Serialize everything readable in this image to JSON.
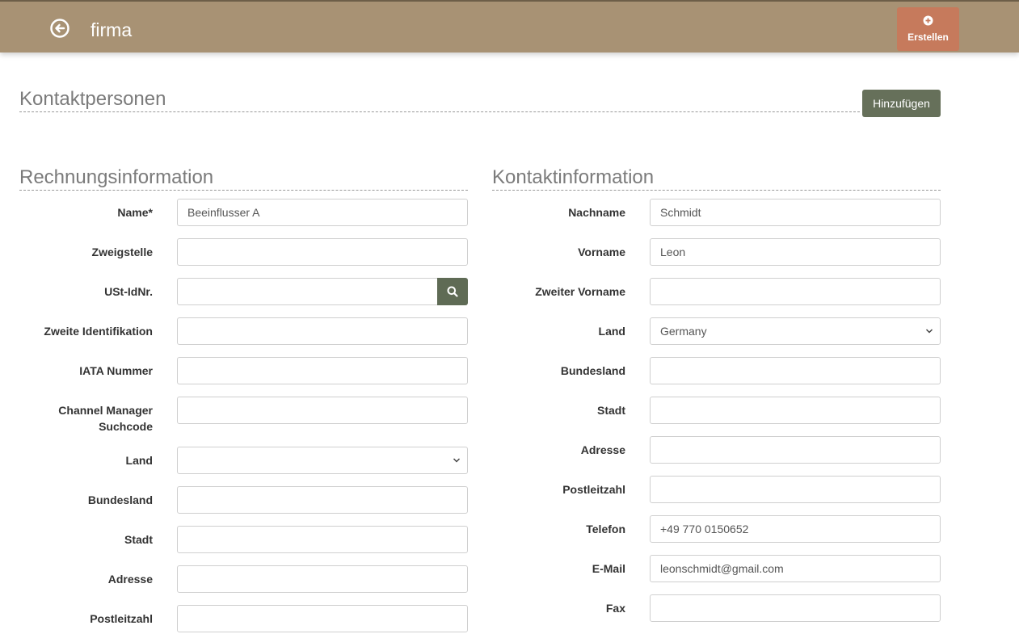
{
  "header": {
    "title": "firma",
    "create_label": "Erstellen"
  },
  "contacts": {
    "heading": "Kontaktpersonen",
    "add_label": "Hinzufügen"
  },
  "billing": {
    "heading": "Rechnungsinformation",
    "fields": [
      {
        "label": "Name*",
        "value": ""
      },
      {
        "label": "Zweigstelle",
        "value": ""
      },
      {
        "label": "USt-IdNr.",
        "value": ""
      },
      {
        "label": "Zweite Identifikation",
        "value": ""
      },
      {
        "label": "IATA Nummer",
        "value": ""
      },
      {
        "label": "Channel Manager Suchcode",
        "value": ""
      },
      {
        "label": "Land",
        "value": ""
      },
      {
        "label": "Bundesland",
        "value": ""
      },
      {
        "label": "Stadt",
        "value": ""
      },
      {
        "label": "Adresse",
        "value": ""
      },
      {
        "label": "Postleitzahl",
        "value": ""
      }
    ],
    "name_value": "Beeinflusser A"
  },
  "contact_info": {
    "heading": "Kontaktinformation",
    "fields": [
      {
        "label": "Nachname",
        "value": "Schmidt"
      },
      {
        "label": "Vorname",
        "value": "Leon"
      },
      {
        "label": "Zweiter Vorname",
        "value": ""
      },
      {
        "label": "Land",
        "value": "Germany"
      },
      {
        "label": "Bundesland",
        "value": ""
      },
      {
        "label": "Stadt",
        "value": ""
      },
      {
        "label": "Adresse",
        "value": ""
      },
      {
        "label": "Postleitzahl",
        "value": ""
      },
      {
        "label": "Telefon",
        "value": "+49 770 0150652"
      },
      {
        "label": "E-Mail",
        "value": "leonschmidt@gmail.com"
      },
      {
        "label": "Fax",
        "value": ""
      }
    ]
  },
  "icons": {
    "back": "arrow-circle-left-icon",
    "create": "plus-circle-icon",
    "search": "search-icon",
    "select": "chevron-down-icon"
  },
  "colors": {
    "header": "#a89274",
    "create_button": "#c67a5c",
    "primary_button": "#66705a"
  }
}
